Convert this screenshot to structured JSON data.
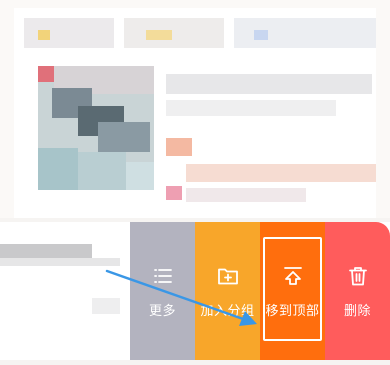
{
  "swipe_actions": [
    {
      "key": "more",
      "label": "更多",
      "icon": "list-icon",
      "color": "#b3b3bf"
    },
    {
      "key": "group",
      "label": "加入分组",
      "icon": "add-folder-icon",
      "color": "#f8a62a"
    },
    {
      "key": "top",
      "label": "移到顶部",
      "icon": "move-to-top-icon",
      "color": "#ff6e0d",
      "highlighted": true
    },
    {
      "key": "delete",
      "label": "删除",
      "icon": "trash-icon",
      "color": "#ff5c5c"
    }
  ],
  "annotation": {
    "arrow_color": "#3a97e6",
    "frame_color": "#ffffff"
  }
}
